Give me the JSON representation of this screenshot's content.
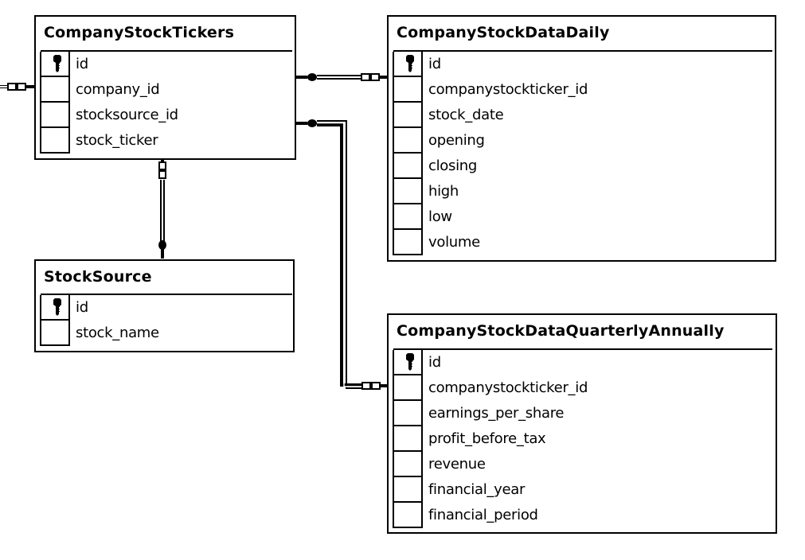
{
  "diagram": {
    "tables": [
      {
        "name": "CompanyStockTickers",
        "columns": [
          {
            "name": "id",
            "primary_key": true
          },
          {
            "name": "company_id",
            "primary_key": false
          },
          {
            "name": "stocksource_id",
            "primary_key": false
          },
          {
            "name": "stock_ticker",
            "primary_key": false
          }
        ]
      },
      {
        "name": "CompanyStockDataDaily",
        "columns": [
          {
            "name": "id",
            "primary_key": true
          },
          {
            "name": "companystockticker_id",
            "primary_key": false
          },
          {
            "name": "stock_date",
            "primary_key": false
          },
          {
            "name": "opening",
            "primary_key": false
          },
          {
            "name": "closing",
            "primary_key": false
          },
          {
            "name": "high",
            "primary_key": false
          },
          {
            "name": "low",
            "primary_key": false
          },
          {
            "name": "volume",
            "primary_key": false
          }
        ]
      },
      {
        "name": "StockSource",
        "columns": [
          {
            "name": "id",
            "primary_key": true
          },
          {
            "name": "stock_name",
            "primary_key": false
          }
        ]
      },
      {
        "name": "CompanyStockDataQuarterlyAnnually",
        "columns": [
          {
            "name": "id",
            "primary_key": true
          },
          {
            "name": "companystockticker_id",
            "primary_key": false
          },
          {
            "name": "earnings_per_share",
            "primary_key": false
          },
          {
            "name": "profit_before_tax",
            "primary_key": false
          },
          {
            "name": "revenue",
            "primary_key": false
          },
          {
            "name": "financial_year",
            "primary_key": false
          },
          {
            "name": "financial_period",
            "primary_key": false
          }
        ]
      }
    ],
    "relationships": [
      {
        "from": "CompanyStockTickers",
        "to": "(offscreen table)",
        "one_end": "offscreen",
        "many_end": "CompanyStockTickers"
      },
      {
        "from": "CompanyStockDataDaily.companystockticker_id",
        "to": "CompanyStockTickers.id",
        "one_end": "CompanyStockTickers",
        "many_end": "CompanyStockDataDaily"
      },
      {
        "from": "CompanyStockDataQuarterlyAnnually.companystockticker_id",
        "to": "CompanyStockTickers.id",
        "one_end": "CompanyStockTickers",
        "many_end": "CompanyStockDataQuarterlyAnnually"
      },
      {
        "from": "CompanyStockTickers.stocksource_id",
        "to": "StockSource.id",
        "one_end": "StockSource",
        "many_end": "CompanyStockTickers"
      }
    ]
  },
  "colors": {
    "line": "#000000",
    "background": "#ffffff"
  }
}
